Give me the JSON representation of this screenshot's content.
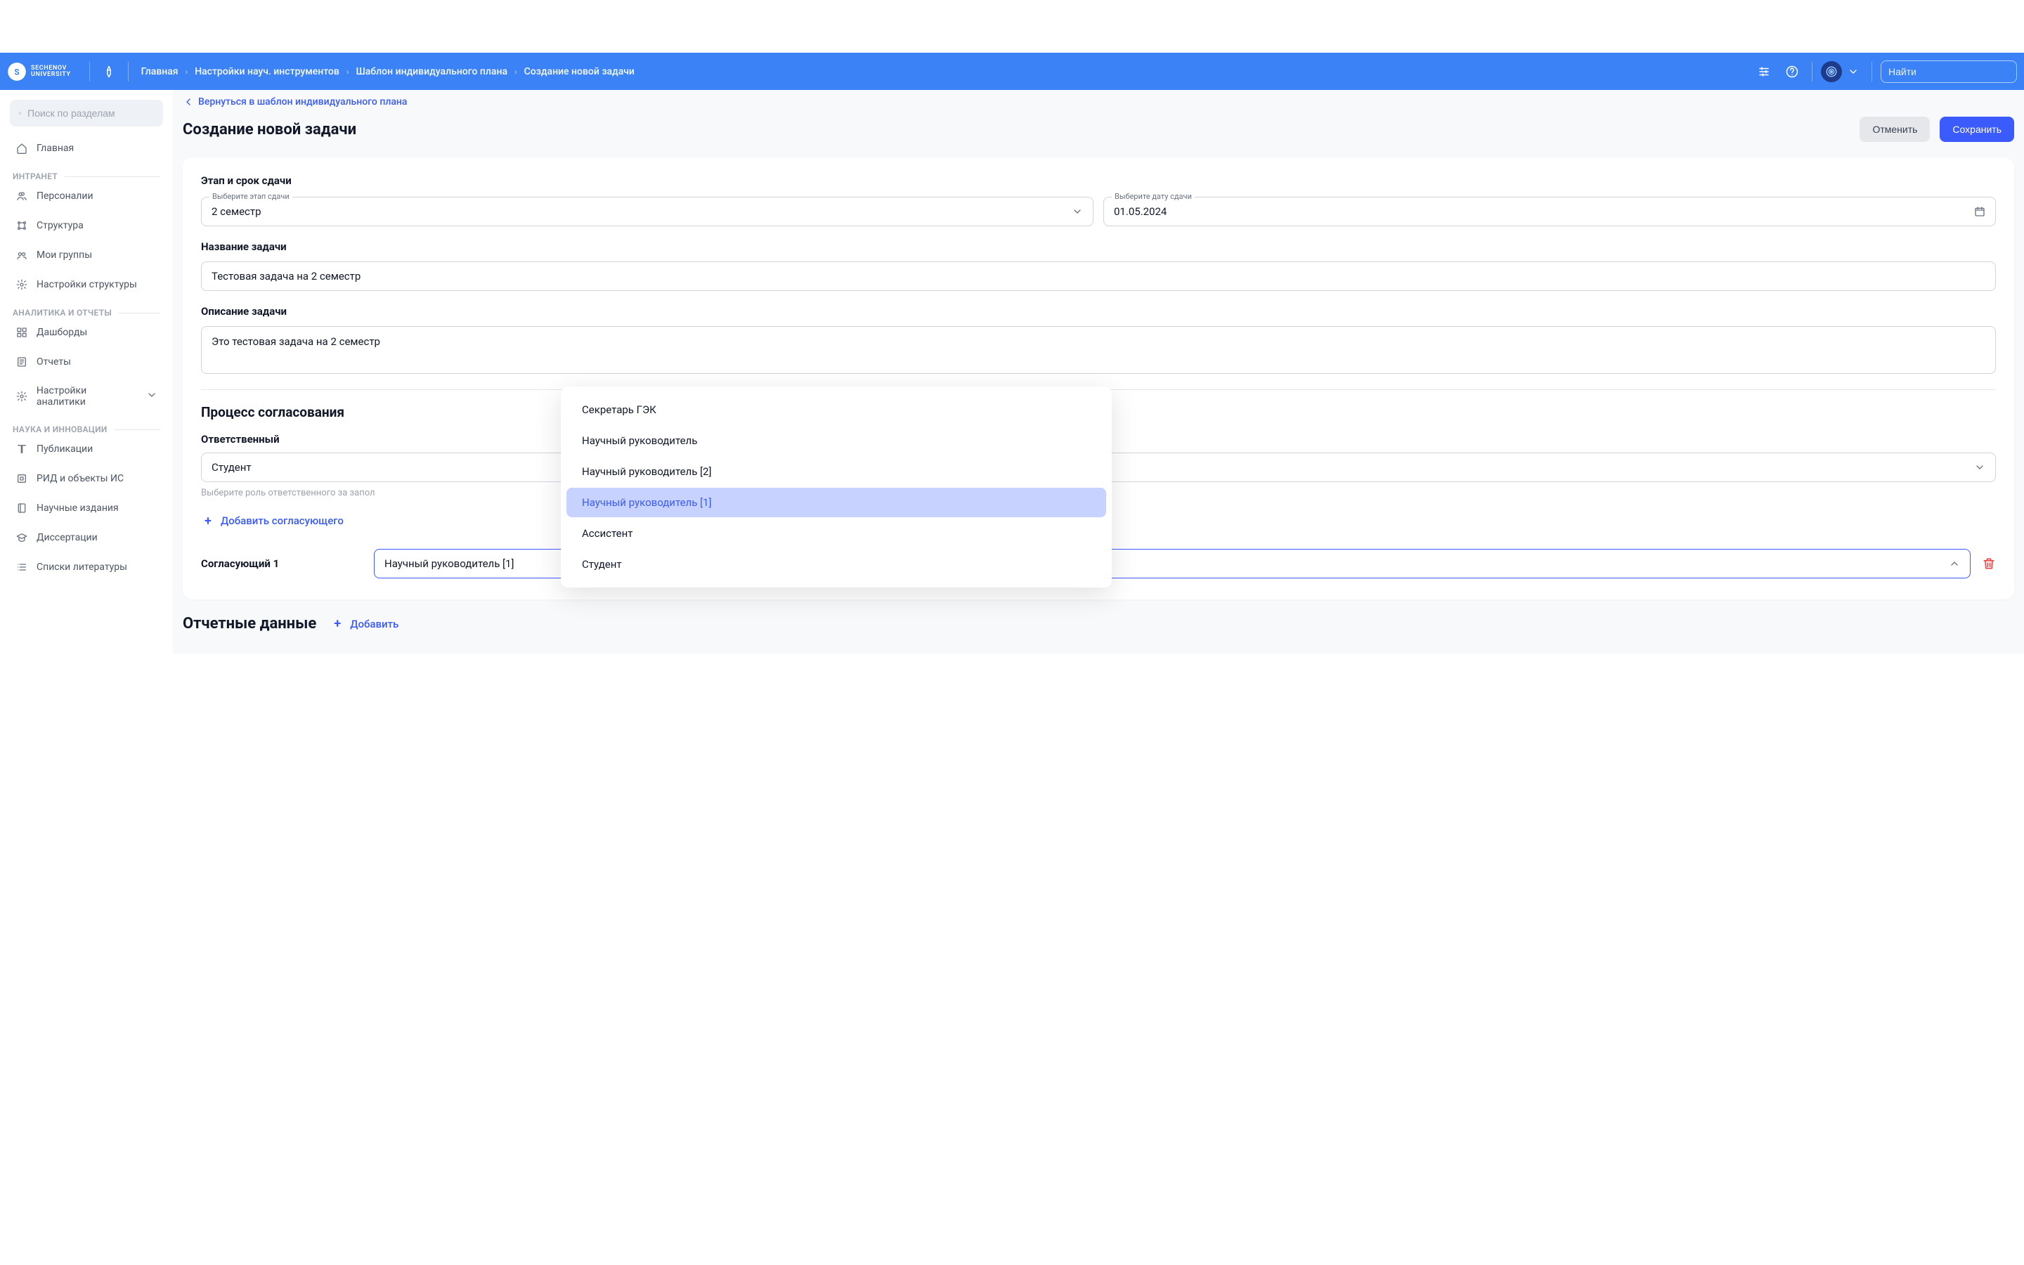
{
  "brand": {
    "line1": "SECHENOV",
    "line2": "UNIVERSITY"
  },
  "breadcrumb": [
    "Главная",
    "Настройки науч. инструментов",
    "Шаблон индивидуального плана",
    "Создание новой задачи"
  ],
  "top_search_placeholder": "Найти",
  "sidebar": {
    "search_placeholder": "Поиск по разделам",
    "home": "Главная",
    "sections": {
      "intranet": {
        "title": "ИНТРАНЕТ",
        "items": [
          "Персоналии",
          "Структура",
          "Мои группы",
          "Настройки структуры"
        ]
      },
      "analytics": {
        "title": "АНАЛИТИКА И ОТЧЕТЫ",
        "items": [
          "Дашборды",
          "Отчеты",
          "Настройки аналитики"
        ]
      },
      "science": {
        "title": "НАУКА И ИННОВАЦИИ",
        "items": [
          "Публикации",
          "РИД и объекты ИС",
          "Научные издания",
          "Диссертации",
          "Списки литературы"
        ]
      }
    }
  },
  "back_link": "Вернуться в шаблон индивидуального плана",
  "page_title": "Создание новой задачи",
  "buttons": {
    "cancel": "Отменить",
    "save": "Сохранить"
  },
  "form": {
    "stage_section": "Этап и срок сдачи",
    "stage_label": "Выберите этап сдачи",
    "stage_value": "2 семестр",
    "date_label": "Выберите дату сдачи",
    "date_value": "01.05.2024",
    "name_label": "Название задачи",
    "name_value": "Тестовая задача на 2 семестр",
    "desc_label": "Описание задачи",
    "desc_value": "Это тестовая задача на 2 семестр",
    "approval_title": "Процесс согласования",
    "responsible_label": "Ответственный",
    "responsible_value": "Студент",
    "responsible_help": "Выберите роль ответственного за запол",
    "add_approver": "Добавить согласующего",
    "approver1_label": "Согласующий 1",
    "approver1_value": "Научный руководитель [1] "
  },
  "dropdown": {
    "options": [
      "Секретарь ГЭК",
      "Научный руководитель",
      "Научный руководитель [2]",
      "Научный руководитель [1]",
      "Ассистент",
      "Студент"
    ],
    "selected_index": 3
  },
  "report_section": {
    "title": "Отчетные данные",
    "add": "Добавить"
  }
}
